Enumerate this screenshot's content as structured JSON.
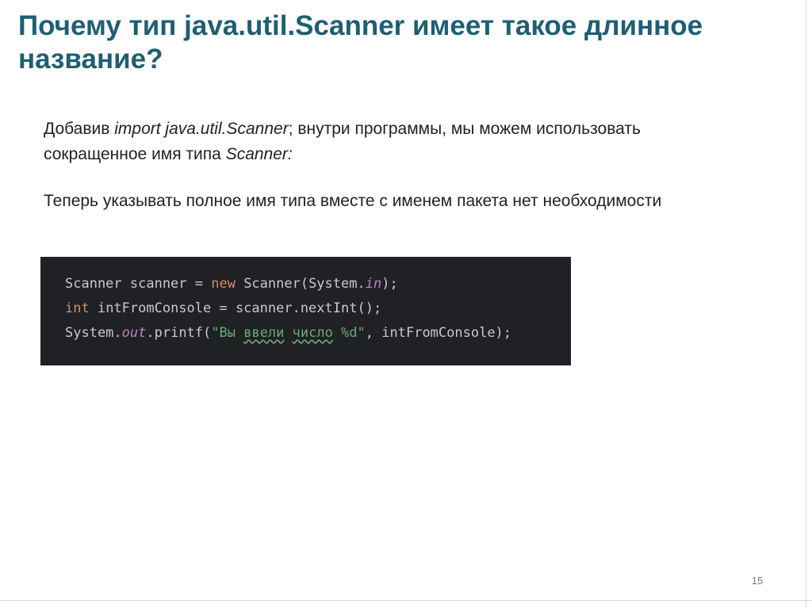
{
  "slide": {
    "title": "Почему тип java.util.Scanner имеет такое длинное название?",
    "paragraph1": {
      "part1": "Добавив ",
      "import_italic": "import java.util.Scanner",
      "part2": "; внутри программы, мы можем использовать сокращенное имя типа ",
      "type_italic": "Scanner:"
    },
    "paragraph2": "Теперь указывать полное имя типа вместе с именем пакета нет необходимости",
    "code": {
      "line1": {
        "a": "Scanner scanner = ",
        "new_kw": "new",
        "b": " Scanner(System.",
        "in_field": "in",
        "c": ");"
      },
      "line2": {
        "int_kw": "int",
        "a": " intFromConsole = scanner.nextInt();"
      },
      "line3": {
        "a": "System.",
        "out_field": "out",
        "b": ".printf(",
        "str1": "\"Вы ",
        "str_typo1": "ввели",
        "str_space": " ",
        "str_typo2": "число",
        "str2": " %d\"",
        "c": ", intFromConsole);"
      }
    },
    "page_number": "15"
  },
  "colors": {
    "title": "#1e5f72",
    "code_background": "#1f2124",
    "keyword": "#cf8e6d",
    "static_field": "#c77dbb",
    "string": "#6aab73"
  }
}
